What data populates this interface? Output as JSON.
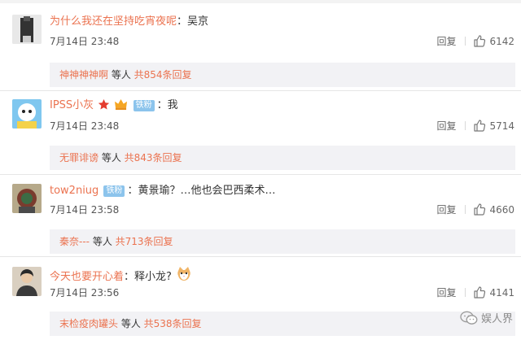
{
  "comments": [
    {
      "username": "为什么我还在坚持吃宵夜呢",
      "text": "：吴京",
      "badge": "",
      "time": "7月14日 23:48",
      "reply_label": "回复",
      "likes": "6142",
      "thread": {
        "name": "神神神神啊",
        "etal": " 等人 ",
        "total": "共854条回复"
      }
    },
    {
      "username": "IPSS小灰",
      "text": "：我",
      "badge": "铁粉",
      "time": "7月14日 23:48",
      "reply_label": "回复",
      "likes": "5714",
      "thread": {
        "name": "无罪诽谤",
        "etal": " 等人 ",
        "total": "共843条回复"
      }
    },
    {
      "username": "tow2niug",
      "text": "：黄景瑜？…他也会巴西柔术…",
      "badge": "铁粉",
      "time": "7月14日 23:58",
      "reply_label": "回复",
      "likes": "4660",
      "thread": {
        "name": "秦奈---",
        "etal": " 等人 ",
        "total": "共713条回复"
      }
    },
    {
      "username": "今天也要开心着",
      "text": "：释小龙?",
      "badge": "",
      "time": "7月14日 23:56",
      "reply_label": "回复",
      "likes": "4141",
      "thread": {
        "name": "末检疫肉罐头",
        "etal": " 等人 ",
        "total": "共538条回复"
      }
    }
  ],
  "watermark": {
    "text": "娱人界"
  },
  "colors": {
    "name": "#eb7350",
    "badge": "#8cc4ec",
    "reply_box": "#f2f2f5"
  },
  "icons": {
    "like": "thumbs-up-icon",
    "emoji": "cat-emoji-icon",
    "badge_star": "red-star-icon",
    "badge_crown": "crown-icon",
    "wechat": "wechat-icon"
  }
}
